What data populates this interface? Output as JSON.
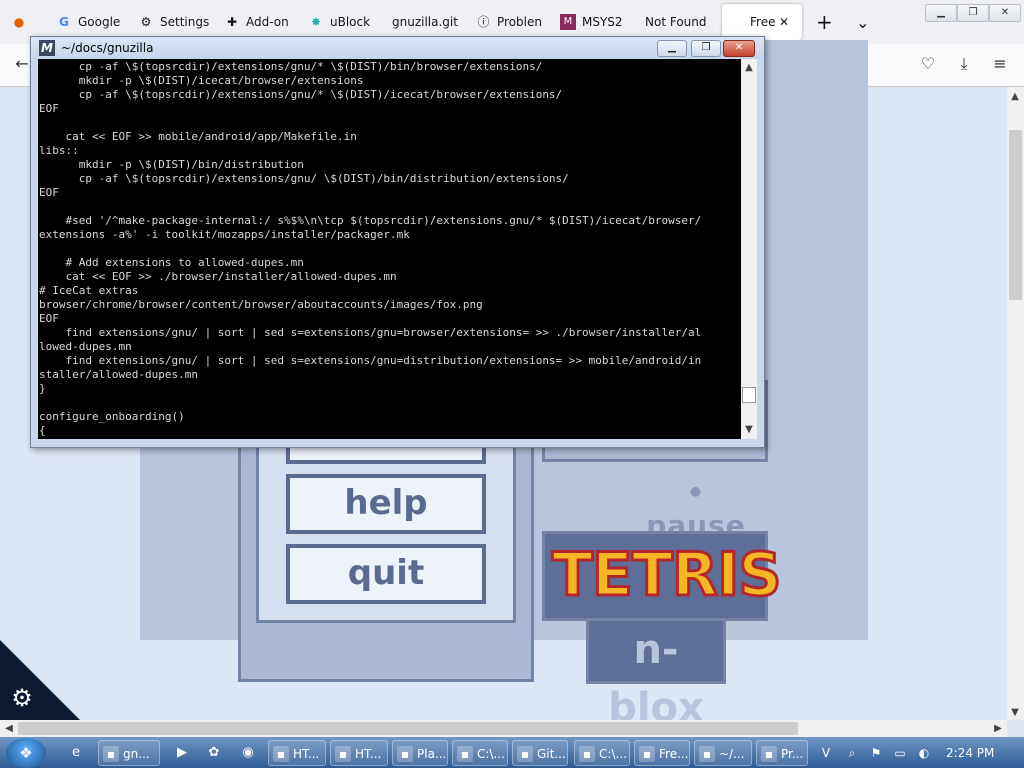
{
  "browser": {
    "tabs": [
      {
        "label": "Google",
        "icon": "google-icon"
      },
      {
        "label": "Settings",
        "icon": "gear-icon"
      },
      {
        "label": "Add-on",
        "icon": "puzzle-icon"
      },
      {
        "label": "uBlock",
        "icon": "ublock-icon"
      },
      {
        "label": "gnuzilla.git",
        "icon": "page-icon"
      },
      {
        "label": "Problen",
        "icon": "info-icon"
      },
      {
        "label": "MSYS2",
        "icon": "msys-icon"
      },
      {
        "label": "Not Found",
        "icon": "page-icon"
      }
    ],
    "active_tab": "Free",
    "new_tab": "+",
    "tab_list": "⌄"
  },
  "terminal": {
    "title": "~/docs/gnuzilla",
    "lines": [
      "      cp -af \\$(topsrcdir)/extensions/gnu/* \\$(DIST)/bin/browser/extensions/",
      "      mkdir -p \\$(DIST)/icecat/browser/extensions",
      "      cp -af \\$(topsrcdir)/extensions/gnu/* \\$(DIST)/icecat/browser/extensions/",
      "EOF",
      "",
      "    cat << EOF >> mobile/android/app/Makefile.in",
      "libs::",
      "      mkdir -p \\$(DIST)/bin/distribution",
      "      cp -af \\$(topsrcdir)/extensions/gnu/ \\$(DIST)/bin/distribution/extensions/",
      "EOF",
      "",
      "    #sed '/^make-package-internal:/ s%$%\\n\\tcp $(topsrcdir)/extensions.gnu/* $(DIST)/icecat/browser/",
      "extensions -a%' -i toolkit/mozapps/installer/packager.mk",
      "",
      "    # Add extensions to allowed-dupes.mn",
      "    cat << EOF >> ./browser/installer/allowed-dupes.mn",
      "# IceCat extras",
      "browser/chrome/browser/content/browser/aboutaccounts/images/fox.png",
      "EOF",
      "    find extensions/gnu/ | sort | sed s=extensions/gnu=browser/extensions= >> ./browser/installer/al",
      "lowed-dupes.mn",
      "    find extensions/gnu/ | sort | sed s=extensions/gnu=distribution/extensions= >> mobile/android/in",
      "staller/allowed-dupes.mn",
      "}",
      "",
      "configure_onboarding()",
      "{"
    ]
  },
  "game": {
    "buttons": [
      "help",
      "quit"
    ],
    "pause_label": "• pause •",
    "logo_title": "TETRIS",
    "logo_sub": "n-blox"
  },
  "taskbar": {
    "items": [
      {
        "label": "gn...",
        "icon": "app-icon"
      },
      {
        "label": "HT...",
        "icon": "help-icon"
      },
      {
        "label": "HT...",
        "icon": "help-icon"
      },
      {
        "label": "Pla...",
        "icon": "app-icon"
      },
      {
        "label": "C:\\...",
        "icon": "archive-icon"
      },
      {
        "label": "Git...",
        "icon": "git-icon"
      },
      {
        "label": "C:\\...",
        "icon": "console-icon"
      },
      {
        "label": "Fre...",
        "icon": "firefox-icon"
      },
      {
        "label": "~/...",
        "icon": "msys-icon"
      },
      {
        "label": "Pr...",
        "icon": "app-icon"
      }
    ],
    "clock": "2:24 PM"
  }
}
